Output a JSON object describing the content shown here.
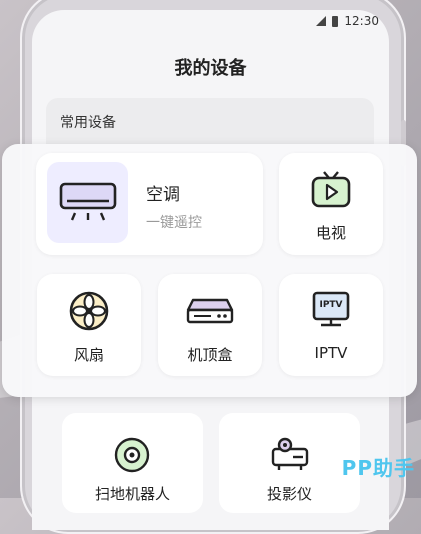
{
  "status_bar": {
    "time": "12:30"
  },
  "page": {
    "title": "我的设备"
  },
  "section": {
    "label": "常用设备"
  },
  "devices": {
    "air_conditioner": {
      "name": "空调",
      "subtitle": "一键遥控"
    },
    "tv": {
      "name": "电视"
    },
    "fan": {
      "name": "风扇"
    },
    "set_top_box": {
      "name": "机顶盒"
    },
    "iptv": {
      "name": "IPTV",
      "icon_text": "IPTV"
    },
    "robot_vacuum": {
      "name": "扫地机器人"
    },
    "projector": {
      "name": "投影仪"
    }
  },
  "watermark": {
    "text": "PP助手"
  },
  "colors": {
    "accent_purple": "#eeedff",
    "tv_green": "#d7f2cf",
    "fan_yellow": "#fbeec7",
    "box_purple": "#ddd0ee",
    "watermark": "#4fc6ee"
  }
}
